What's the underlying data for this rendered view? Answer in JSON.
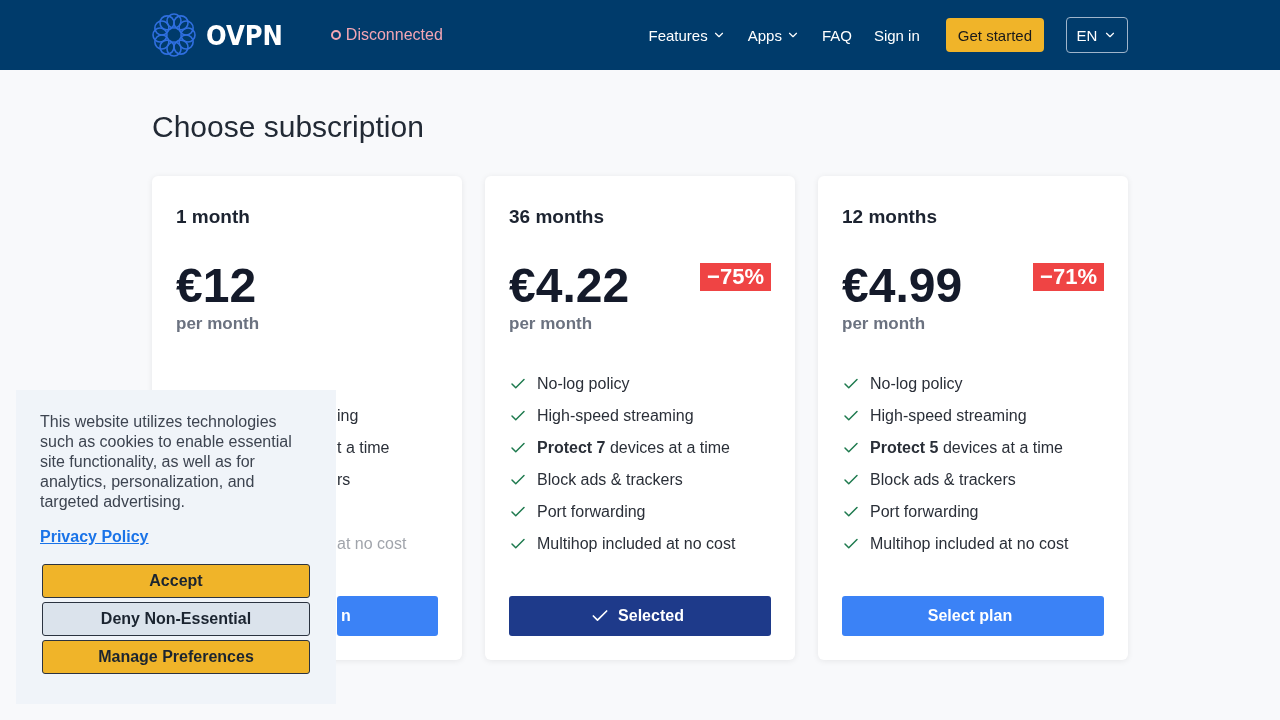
{
  "nav": {
    "logo": "OVPN",
    "status": {
      "text": "Disconnected",
      "connected": false
    },
    "links": [
      {
        "label": "Features",
        "dropdown": true
      },
      {
        "label": "Apps",
        "dropdown": true
      },
      {
        "label": "FAQ",
        "dropdown": false
      },
      {
        "label": "Sign in",
        "dropdown": false
      }
    ],
    "cta": "Get started",
    "language": "EN"
  },
  "heading": "Choose subscription",
  "plans": [
    {
      "title": "1 month",
      "price": "€12",
      "period": "per month",
      "covered": true,
      "features": [
        {
          "text": "ing"
        },
        {
          "text": "t a time"
        },
        {
          "text": "rs"
        },
        {
          "text": "at no cost",
          "disabled": true
        }
      ],
      "button": {
        "label": "n",
        "selected": false
      }
    },
    {
      "title": "36 months",
      "price": "€4.22",
      "period": "per month",
      "discount": "−75%",
      "covered": false,
      "features": [
        {
          "text": "No-log policy"
        },
        {
          "text": "High-speed streaming"
        },
        {
          "text": "**Protect 7** devices at a time"
        },
        {
          "text": "Block ads & trackers"
        },
        {
          "text": "Port forwarding"
        },
        {
          "text": "Multihop included at no cost"
        }
      ],
      "button": {
        "label": "Selected",
        "selected": true
      }
    },
    {
      "title": "12 months",
      "price": "€4.99",
      "period": "per month",
      "discount": "−71%",
      "covered": false,
      "features": [
        {
          "text": "No-log policy"
        },
        {
          "text": "High-speed streaming"
        },
        {
          "text": "**Protect 5** devices at a time"
        },
        {
          "text": "Block ads & trackers"
        },
        {
          "text": "Port forwarding"
        },
        {
          "text": "Multihop included at no cost"
        }
      ],
      "button": {
        "label": "Select plan",
        "selected": false
      }
    }
  ],
  "cookie_banner": {
    "text": "This website utilizes technologies such as cookies to enable essential site functionality, as well as for analytics, personalization, and targeted advertising.",
    "link": "Privacy Policy",
    "buttons": [
      {
        "label": "Accept",
        "kind": "primary"
      },
      {
        "label": "Deny Non-Essential",
        "kind": "secondary"
      },
      {
        "label": "Manage Preferences",
        "kind": "primary"
      }
    ]
  }
}
